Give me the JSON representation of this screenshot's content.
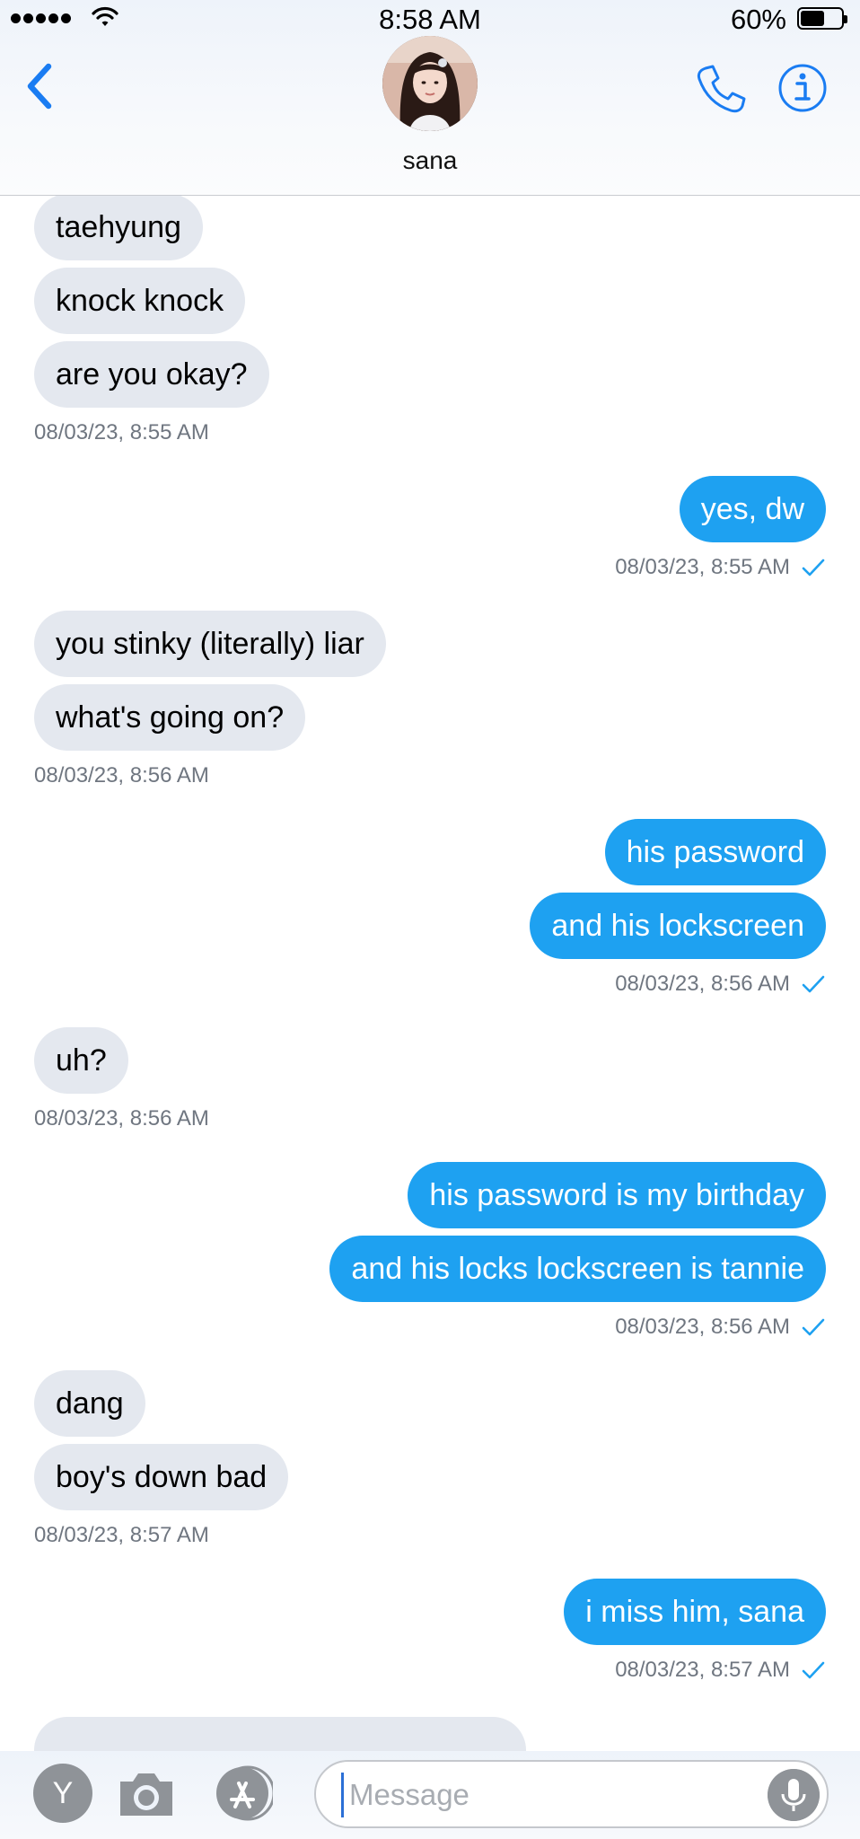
{
  "status_bar": {
    "time": "8:58 AM",
    "battery": "60%",
    "battery_level": 0.6
  },
  "header": {
    "contact_name": "sana"
  },
  "messages": [
    {
      "side": "in",
      "text": "taehyung"
    },
    {
      "side": "in",
      "text": "knock knock"
    },
    {
      "side": "in",
      "text": "are you okay?"
    },
    {
      "type": "timestamp",
      "side": "in",
      "text": "08/03/23, 8:55 AM"
    },
    {
      "side": "out",
      "text": "yes, dw"
    },
    {
      "type": "timestamp",
      "side": "out",
      "text": "08/03/23, 8:55 AM",
      "read": true
    },
    {
      "side": "in",
      "text": "you stinky (literally) liar"
    },
    {
      "side": "in",
      "text": "what's going on?"
    },
    {
      "type": "timestamp",
      "side": "in",
      "text": "08/03/23, 8:56 AM"
    },
    {
      "side": "out",
      "text": "his password"
    },
    {
      "side": "out",
      "text": "and his lockscreen"
    },
    {
      "type": "timestamp",
      "side": "out",
      "text": "08/03/23, 8:56 AM",
      "read": true
    },
    {
      "side": "in",
      "text": "uh?"
    },
    {
      "type": "timestamp",
      "side": "in",
      "text": "08/03/23, 8:56 AM"
    },
    {
      "side": "out",
      "text": "his password is my birthday"
    },
    {
      "side": "out",
      "text": "and his locks lockscreen is tannie"
    },
    {
      "type": "timestamp",
      "side": "out",
      "text": "08/03/23, 8:56 AM",
      "read": true
    },
    {
      "side": "in",
      "text": "dang"
    },
    {
      "side": "in",
      "text": "boy's down bad"
    },
    {
      "type": "timestamp",
      "side": "in",
      "text": "08/03/23, 8:57 AM"
    },
    {
      "side": "out",
      "text": "i miss him, sana"
    },
    {
      "type": "timestamp",
      "side": "out",
      "text": "08/03/23, 8:57 AM",
      "read": true
    }
  ],
  "composer": {
    "placeholder": "Message",
    "value": "",
    "app_icon_letter": "Y"
  },
  "colors": {
    "incoming_bubble": "#e4e8ef",
    "outgoing_bubble": "#1ea1f1",
    "accent": "#1a7cf2",
    "timestamp": "#6f7680"
  },
  "icons": [
    "back-chevron-icon",
    "phone-icon",
    "info-icon",
    "yahoo-icon",
    "camera-icon",
    "app-store-icon",
    "microphone-icon",
    "read-checkmark-icon"
  ]
}
